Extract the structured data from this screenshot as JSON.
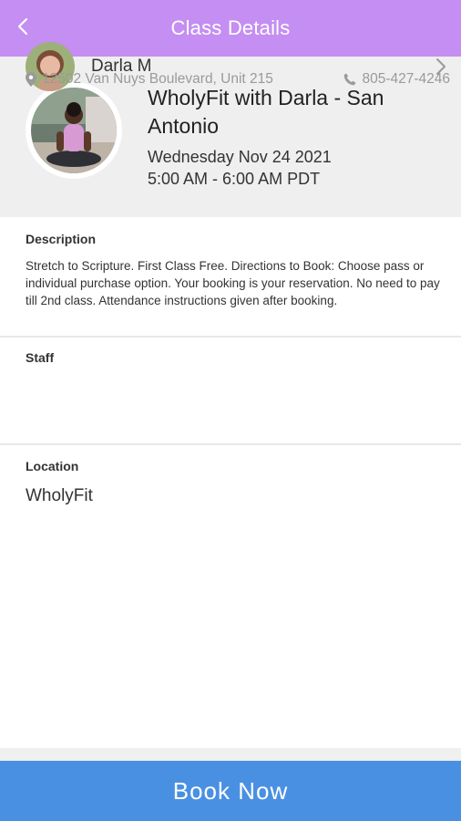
{
  "header": {
    "title": "Class Details",
    "back_icon": "chevron-left-icon",
    "color": "#c48ef2"
  },
  "class": {
    "title": "WholyFit with Darla - San Antonio",
    "date": "Wednesday Nov 24 2021",
    "time": "5:00 AM - 6:00 AM PDT",
    "image_icon": "instructor-photo"
  },
  "description": {
    "label": "Description",
    "text": "Stretch to Scripture. First Class Free. Directions to Book: Choose pass or individual purchase option. Your booking is your reservation. No need to pay till 2nd class. Attendance instructions given after booking."
  },
  "staff": {
    "label": "Staff",
    "name": "Darla M",
    "icon": "chevron-right-icon"
  },
  "location": {
    "label": "Location",
    "name": "WholyFit",
    "address": "12502 Van Nuys Boulevard, Unit 215",
    "address_icon": "map-pin-icon",
    "phone": "805-427-4246",
    "phone_icon": "phone-icon"
  },
  "actions": {
    "book_label": "Book Now",
    "book_color": "#4a90e2"
  }
}
